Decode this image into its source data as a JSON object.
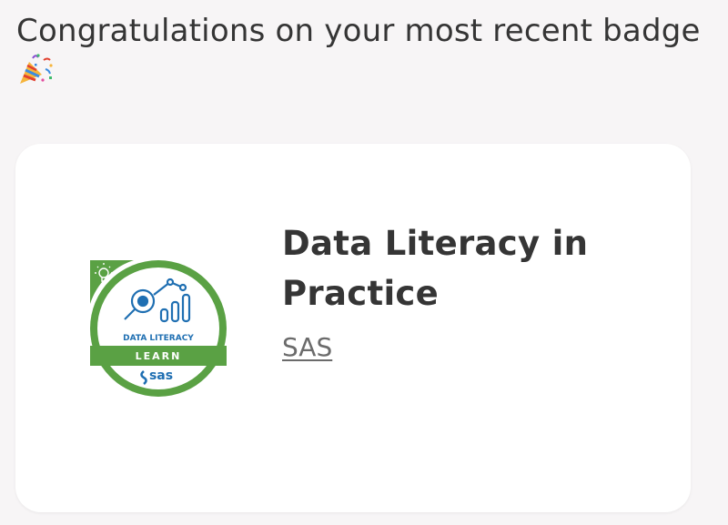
{
  "header": {
    "title": "Congratulations on your most recent badge",
    "icon": "party-popper-icon"
  },
  "badge_card": {
    "title": "Data Literacy in Practice",
    "issuer": "SAS",
    "badge_image": {
      "subject": "DATA LITERACY",
      "level": "LEARN",
      "brand": "sas",
      "colors": {
        "ring": "#5aa144",
        "band": "#5aa144",
        "icon": "#1f6fb2",
        "text": "#ffffff",
        "inner": "#ffffff"
      }
    }
  }
}
